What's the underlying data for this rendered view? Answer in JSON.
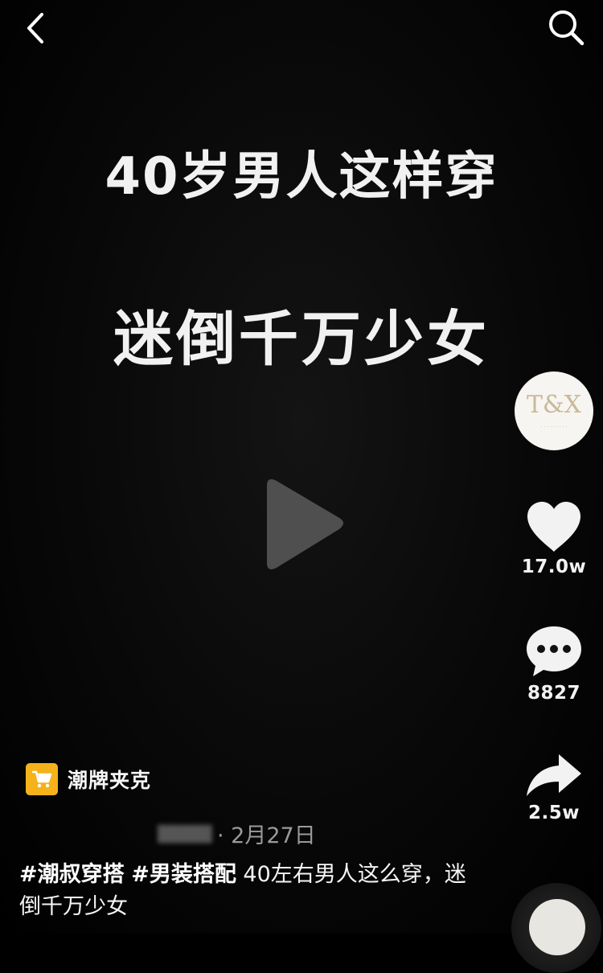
{
  "overlay": {
    "line1": "40岁男人这样穿",
    "line2": "迷倒千万少女"
  },
  "topbar": {
    "back_icon": "chevron-left-icon",
    "search_icon": "search-icon"
  },
  "rail": {
    "avatar_logo": "T&X",
    "likes": "17.0w",
    "comments": "8827",
    "shares": "2.5w"
  },
  "product": {
    "icon": "shopping-cart-icon",
    "label": "潮牌夹克"
  },
  "author": {
    "date": "· 2月27日"
  },
  "caption": {
    "tag1": "#潮叔穿搭",
    "tag2": "#男装搭配",
    "text": " 40左右男人这么穿，迷倒千万少女"
  },
  "colors": {
    "background": "#000000",
    "cart_badge": "#f5b21a",
    "text": "#ffffff",
    "muted": "#9a9a9a"
  }
}
